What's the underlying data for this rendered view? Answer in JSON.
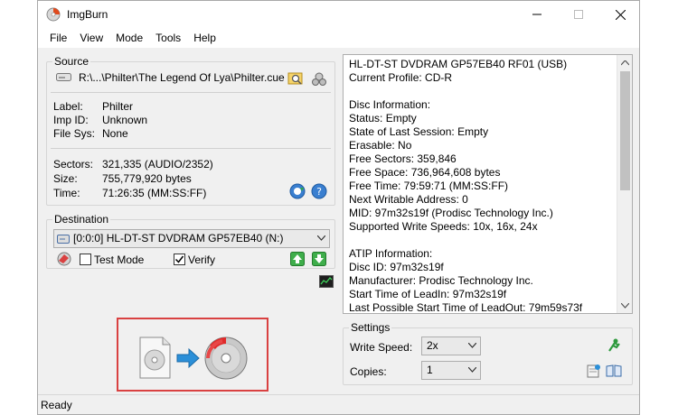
{
  "window": {
    "title": "ImgBurn"
  },
  "menu": [
    "File",
    "View",
    "Mode",
    "Tools",
    "Help"
  ],
  "source": {
    "legend": "Source",
    "path": "R:\\...\\Philter\\The Legend Of Lya\\Philter.cue",
    "label_key": "Label:",
    "label_val": "Philter",
    "impid_key": "Imp ID:",
    "impid_val": "Unknown",
    "filesys_key": "File Sys:",
    "filesys_val": "None",
    "sectors_key": "Sectors:",
    "sectors_val": "321,335 (AUDIO/2352)",
    "size_key": "Size:",
    "size_val": "755,779,920 bytes",
    "time_key": "Time:",
    "time_val": "71:26:35 (MM:SS:FF)"
  },
  "destination": {
    "legend": "Destination",
    "drive": "[0:0:0] HL-DT-ST DVDRAM GP57EB40 (N:)",
    "test_mode_label": "Test Mode",
    "test_mode_checked": false,
    "verify_label": "Verify",
    "verify_checked": true
  },
  "info_lines": [
    "HL-DT-ST DVDRAM GP57EB40 RF01 (USB)",
    "Current Profile: CD-R",
    "",
    "Disc Information:",
    "Status: Empty",
    "State of Last Session: Empty",
    "Erasable: No",
    "Free Sectors: 359,846",
    "Free Space: 736,964,608 bytes",
    "Free Time: 79:59:71 (MM:SS:FF)",
    "Next Writable Address: 0",
    "MID: 97m32s19f (Prodisc Technology Inc.)",
    "Supported Write Speeds: 10x, 16x, 24x",
    "",
    "ATIP Information:",
    "Disc ID: 97m32s19f",
    "Manufacturer: Prodisc Technology Inc.",
    "Start Time of LeadIn: 97m32s19f",
    "Last Possible Start Time of LeadOut: 79m59s73f"
  ],
  "settings": {
    "legend": "Settings",
    "write_speed_label": "Write Speed:",
    "write_speed_value": "2x",
    "copies_label": "Copies:",
    "copies_value": "1"
  },
  "status": "Ready",
  "colors": {
    "accent_red": "#d94141",
    "arrow_blue": "#2b8fd8",
    "green_icon": "#2e9a3e"
  }
}
